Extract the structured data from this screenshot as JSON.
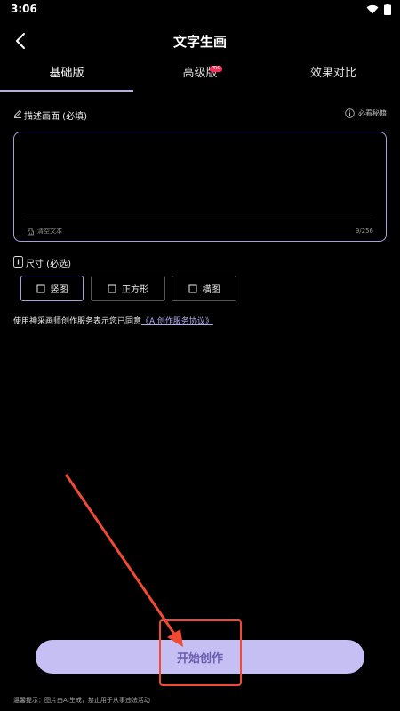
{
  "status_bar": {
    "time": "3:06"
  },
  "nav": {
    "title": "文字生画"
  },
  "tabs": [
    {
      "label": "基础版",
      "active": true
    },
    {
      "label": "高级版",
      "badge": "PRO"
    },
    {
      "label": "效果对比"
    }
  ],
  "description": {
    "label": "描述画面 (必填)",
    "tips_link": "必看秘籍",
    "value": "",
    "clear_label": "清空文本",
    "char_count": "9/256"
  },
  "size": {
    "label": "尺寸 (必选)",
    "options": [
      {
        "label": "竖图",
        "selected": true
      },
      {
        "label": "正方形"
      },
      {
        "label": "横图"
      }
    ]
  },
  "agreement": {
    "text": "使用神采画师创作服务表示您已同意",
    "link": "《AI创作服务协议》"
  },
  "start_button": {
    "label": "开始创作"
  },
  "footer": {
    "warm_tip": "温馨提示：图片由AI生成，禁止用于从事违法活动"
  },
  "colors": {
    "accent": "#b4aef0",
    "button_bg": "#c6bff4",
    "button_text": "#6a5cae",
    "annotation": "#f04a34"
  }
}
